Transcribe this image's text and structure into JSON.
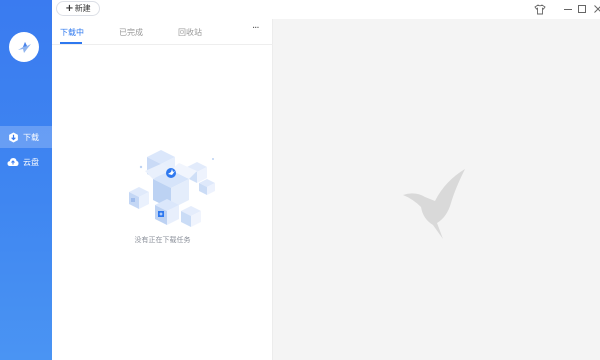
{
  "app": {
    "brand_color": "#3a7bf0",
    "accent_color": "#2e78ef"
  },
  "toolbar": {
    "new_label": "新建",
    "new_icon": "plus-icon"
  },
  "window_controls": [
    "skin-icon",
    "minimize-icon",
    "maximize-icon",
    "close-icon"
  ],
  "sidebar": {
    "logo_icon": "hummingbird-logo-icon",
    "items": [
      {
        "label": "下载",
        "icon": "download-icon",
        "active": true
      },
      {
        "label": "云盘",
        "icon": "cloud-icon",
        "active": false
      }
    ]
  },
  "tabs": [
    {
      "label": "下载中",
      "active": true
    },
    {
      "label": "已完成",
      "active": false
    },
    {
      "label": "回收站",
      "active": false
    }
  ],
  "more_label": "···",
  "empty_state": {
    "message": "没有正在下载任务",
    "illustration": "empty-boxes-illustration"
  },
  "detail_pane": {
    "watermark": "hummingbird-watermark-icon"
  }
}
